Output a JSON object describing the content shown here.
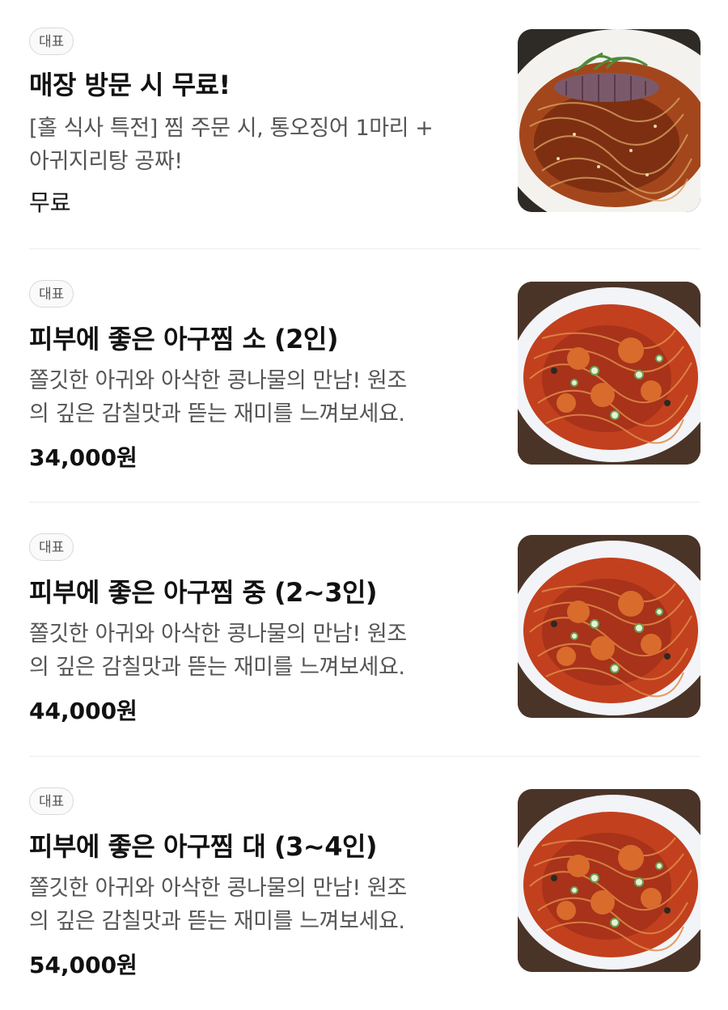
{
  "menu": {
    "items": [
      {
        "badge": "대표",
        "name": "매장 방문 시 무료!",
        "desc_lines": [
          "[홀 식사 특전] 찜 주문 시, 통오징어 1마리 +",
          "아귀지리탕 공짜!"
        ],
        "price": "무료",
        "image": "squid-monkfish-dish-photo"
      },
      {
        "badge": "대표",
        "name": "피부에 좋은 아구찜 소 (2인)",
        "desc_lines": [
          "쫄깃한 아귀와 아삭한 콩나물의 만남! 원조",
          "의 깊은 감칠맛과 뜯는 재미를 느껴보세요."
        ],
        "price": "34,000원",
        "image": "braised-monkfish-photo"
      },
      {
        "badge": "대표",
        "name": "피부에 좋은 아구찜 중 (2~3인)",
        "desc_lines": [
          "쫄깃한 아귀와 아삭한 콩나물의 만남! 원조",
          "의 깊은 감칠맛과 뜯는 재미를 느껴보세요."
        ],
        "price": "44,000원",
        "image": "braised-monkfish-photo"
      },
      {
        "badge": "대표",
        "name": "피부에 좋은 아구찜 대 (3~4인)",
        "desc_lines": [
          "쫄깃한 아귀와 아삭한 콩나물의 만남! 원조",
          "의 깊은 감칠맛과 뜯는 재미를 느껴보세요."
        ],
        "price": "54,000원",
        "image": "braised-monkfish-photo"
      }
    ]
  },
  "colors": {
    "text_primary": "#111111",
    "text_secondary": "#555555",
    "badge_border": "#d9d9d9",
    "divider": "#ececec",
    "sauce_red": "#b8321a",
    "plate_white": "#f4f2ee"
  }
}
